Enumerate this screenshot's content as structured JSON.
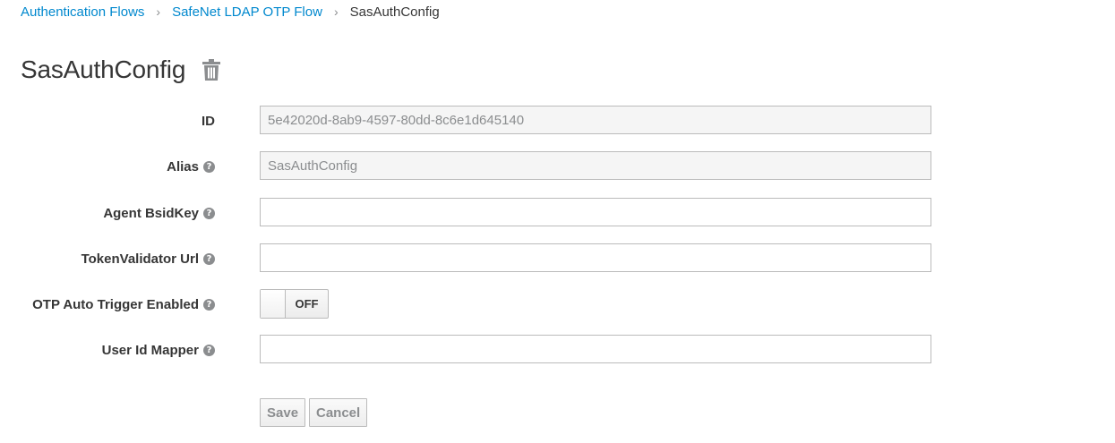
{
  "breadcrumb": {
    "items": [
      "Authentication Flows",
      "SafeNet LDAP OTP Flow"
    ],
    "separator": "›",
    "current": "SasAuthConfig"
  },
  "header": {
    "title": "SasAuthConfig",
    "delete_icon": "trash-icon"
  },
  "form": {
    "id_label": "ID",
    "id_value": "5e42020d-8ab9-4597-80dd-8c6e1d645140",
    "alias_label": "Alias",
    "alias_value": "SasAuthConfig",
    "agent_bsidkey_label": "Agent BsidKey",
    "agent_bsidkey_value": "",
    "tokenvalidator_url_label": "TokenValidator Url",
    "tokenvalidator_url_value": "",
    "otp_auto_trigger_label": "OTP Auto Trigger Enabled",
    "otp_auto_trigger_state": "OFF",
    "user_id_mapper_label": "User Id Mapper",
    "user_id_mapper_value": "",
    "help_glyph": "?"
  },
  "actions": {
    "save_label": "Save",
    "cancel_label": "Cancel"
  },
  "colors": {
    "link": "#0088ce",
    "text": "#363636",
    "muted": "#8b8d8f",
    "border": "#bbbbbb",
    "readonly_bg": "#f5f5f5"
  }
}
